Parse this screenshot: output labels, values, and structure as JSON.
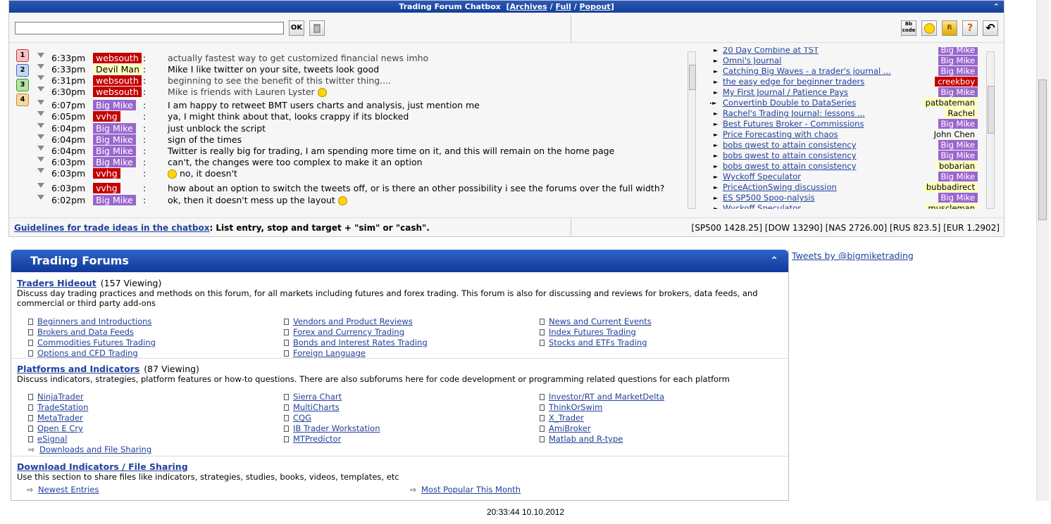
{
  "chatbox": {
    "title": "Trading Forum Chatbox",
    "links": {
      "archives": "Archives",
      "full": "Full",
      "popout": "Popout"
    },
    "ok_label": "OK",
    "bbcode_label": "Bb code",
    "r_label": "R",
    "help_label": "?",
    "num_badges": [
      {
        "label": "1",
        "bg": "#f4c4c4",
        "border": "#c33"
      },
      {
        "label": "2",
        "bg": "#c8d8f4",
        "border": "#46c"
      },
      {
        "label": "3",
        "bg": "#b8e2a0",
        "border": "#393"
      },
      {
        "label": "4",
        "bg": "#f4d8a0",
        "border": "#c83"
      }
    ],
    "messages": [
      {
        "time": "6:33pm",
        "user": "websouth",
        "user_style": "red",
        "text": "actually fastest way to get customized financial news imho",
        "muted": true
      },
      {
        "time": "6:33pm",
        "user": "Devil Man",
        "user_style": "yellow",
        "text": "Mike I like twitter on your site, tweets look good",
        "muted": false
      },
      {
        "time": "6:31pm",
        "user": "websouth",
        "user_style": "red",
        "text": "beginning to see the benefit of this twitter thing....",
        "muted": true
      },
      {
        "time": "6:30pm",
        "user": "websouth",
        "user_style": "red",
        "text": "Mike is friends with Lauren Lyster",
        "muted": true,
        "smiley_after": true
      },
      {
        "time": "6:07pm",
        "user": "Big Mike",
        "user_style": "purple",
        "text": "I am happy to retweet BMT users charts and analysis, just mention me",
        "muted": false
      },
      {
        "time": "6:05pm",
        "user": "vvhg",
        "user_style": "red",
        "text": "ya, I might think about that, looks crappy if its blocked",
        "muted": false
      },
      {
        "time": "6:04pm",
        "user": "Big Mike",
        "user_style": "purple",
        "text": "just unblock the script",
        "muted": false
      },
      {
        "time": "6:04pm",
        "user": "Big Mike",
        "user_style": "purple",
        "text": "sign of the times",
        "muted": false
      },
      {
        "time": "6:04pm",
        "user": "Big Mike",
        "user_style": "purple",
        "text": "Twitter is really big for trading, I am spending more time on it, and this will remain on the home page",
        "muted": false
      },
      {
        "time": "6:03pm",
        "user": "Big Mike",
        "user_style": "purple",
        "text": "can't, the changes were too complex to make it an option",
        "muted": false
      },
      {
        "time": "6:03pm",
        "user": "vvhg",
        "user_style": "red",
        "text": "no, it doesn't",
        "muted": false,
        "smiley_before": true
      },
      {
        "time": "6:03pm",
        "user": "vvhg",
        "user_style": "red",
        "text": "how about an option to switch the tweets off, or is there an other possibility i see the forums over the full width?",
        "muted": false
      },
      {
        "time": "6:02pm",
        "user": "Big Mike",
        "user_style": "purple",
        "text": "ok, then it doesn't mess up the layout",
        "muted": false,
        "smiley_after": true
      }
    ],
    "threads": [
      {
        "title": "20 Day Combine at TST",
        "user": "Big Mike",
        "user_style": "purple"
      },
      {
        "title": "Omni's Journal",
        "user": "Big Mike",
        "user_style": "purple"
      },
      {
        "title": "Catching Big Waves - a trader's journal ...",
        "user": "Big Mike",
        "user_style": "purple"
      },
      {
        "title": "the easy edge for beginner traders",
        "user": "creekboy",
        "user_style": "red"
      },
      {
        "title": "My First Journal / Patience Pays",
        "user": "Big Mike",
        "user_style": "purple"
      },
      {
        "title": "Convertinb Double to DataSeries",
        "user": "patbateman",
        "user_style": "yellow",
        "double_arrow": true
      },
      {
        "title": "Rachel's Trading Journal: lessons ...",
        "user": "Rachel",
        "user_style": "yellow"
      },
      {
        "title": "Best Futures Broker - Commissions",
        "user": "Big Mike",
        "user_style": "purple"
      },
      {
        "title": "Price Forecasting with chaos",
        "user": "John Chen",
        "user_style": "plain"
      },
      {
        "title": "bobs qwest to attain consistency",
        "user": "Big Mike",
        "user_style": "purple"
      },
      {
        "title": "bobs qwest to attain consistency",
        "user": "Big Mike",
        "user_style": "purple"
      },
      {
        "title": "bobs qwest to attain consistency",
        "user": "bobarian",
        "user_style": "yellow"
      },
      {
        "title": "Wyckoff Speculator",
        "user": "Big Mike",
        "user_style": "purple"
      },
      {
        "title": "PriceActionSwing discussion",
        "user": "bubbadirect",
        "user_style": "yellow"
      },
      {
        "title": "ES SP500 Spoo-nalysis",
        "user": "Big Mike",
        "user_style": "purple"
      },
      {
        "title": "Wyckoff Speculator",
        "user": "muscleman",
        "user_style": "yellow"
      }
    ],
    "guidelines_link": "Guidelines for trade ideas in the chatbox",
    "guidelines_text": ": List entry, stop and target + \"sim\" or \"cash\".",
    "quotes": "[SP500 1428.25] [DOW 13290] [NAS 2726.00] [RUS 823.5] [EUR 1.2902]"
  },
  "forums": {
    "title": "Trading Forums",
    "sections": [
      {
        "title": "Traders Hideout",
        "views": "(157 Viewing)",
        "desc": "Discuss day trading practices and methods on this forum, for all markets including futures and forex trading. This forum is also for discussing and reviews for brokers, data feeds, and commercial or third party add-ons",
        "subforums": [
          [
            "Beginners and Introductions",
            "Vendors and Product Reviews",
            "News and Current Events"
          ],
          [
            "Brokers and Data Feeds",
            "Forex and Currency Trading",
            "Index Futures Trading"
          ],
          [
            "Commodities Futures Trading",
            "Bonds and Interest Rates Trading",
            "Stocks and ETFs Trading"
          ],
          [
            "Options and CFD Trading",
            "Foreign Language",
            ""
          ]
        ]
      },
      {
        "title": "Platforms and Indicators",
        "views": "(87 Viewing)",
        "desc": "Discuss indicators, strategies, platform features or how-to questions. There are also subforums here for code development or programming related questions for each platform",
        "subforums": [
          [
            "NinjaTrader",
            "Sierra Chart",
            "Investor/RT and MarketDelta"
          ],
          [
            "TradeStation",
            "MultiCharts",
            "ThinkOrSwim"
          ],
          [
            "MetaTrader",
            "CQG",
            "X_Trader"
          ],
          [
            "Open E Cry",
            "IB Trader Workstation",
            "AmiBroker"
          ],
          [
            "eSignal",
            "MTPredictor",
            "Matlab and R-type"
          ]
        ],
        "extra_link": "Downloads and File Sharing"
      },
      {
        "title": "Download Indicators / File Sharing",
        "views": "",
        "desc": "Use this section to share files like indicators, strategies, studies, books, videos, templates, etc",
        "links": [
          "Newest Entries",
          "Most Popular This Month"
        ]
      }
    ]
  },
  "tweets_link": "Tweets by @bigmiketrading",
  "clock": "20:33:44 10.10.2012",
  "colors": {
    "red": "#c40000",
    "purple": "#9966cc",
    "yellow": "#ffffc0",
    "header_blue": "#1a4aa8",
    "link": "#22419b"
  }
}
